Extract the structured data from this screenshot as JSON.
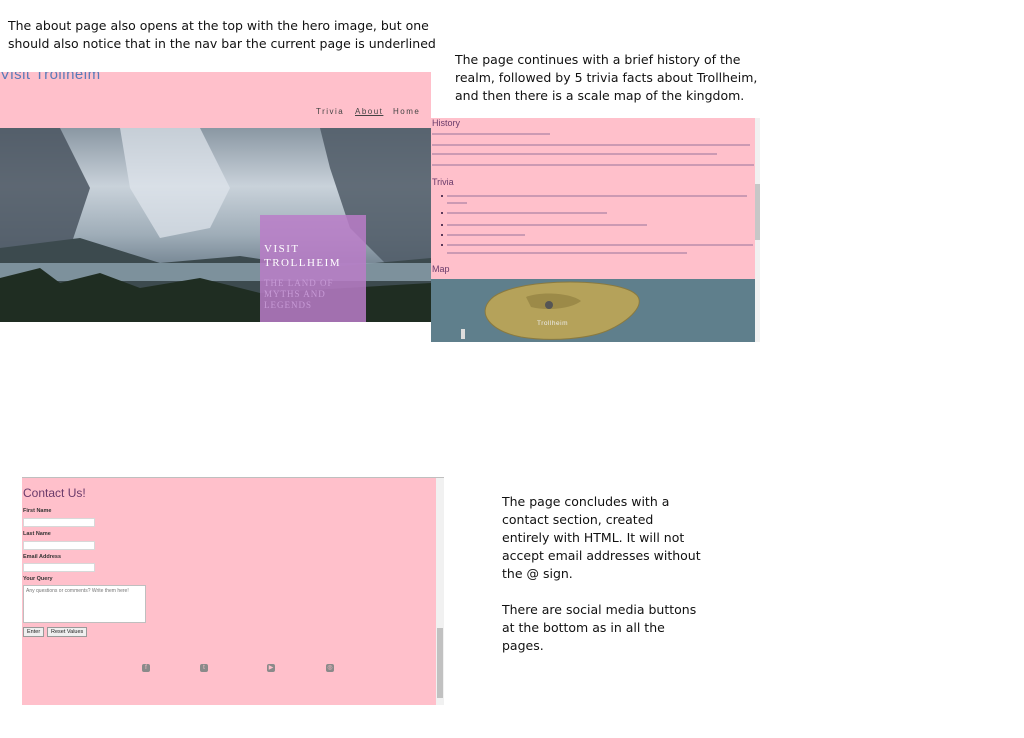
{
  "notes": {
    "top_left": "The about page also opens at the top with the hero image, but one\nshould also notice that in the  nav bar the current page is underlined",
    "top_right": "The page continues with a brief history of the\nrealm, followed by 5 trivia facts about Trollheim,\nand then there is a scale map of the kingdom.",
    "bottom_right_1": "The page concludes with a\ncontact section, created\nentirely with HTML. It will not\naccept email addresses without\nthe @ sign.",
    "bottom_right_2": "There are social media buttons\nat the bottom as in all the\npages."
  },
  "hero": {
    "site_title": "Visit Trollheim",
    "nav": [
      "Trivia",
      "About",
      "Home"
    ],
    "current_nav": "About",
    "box_title": "VISIT\nTROLLHEIM",
    "box_subtitle": "THE LAND OF\nMYTHS AND\nLEGENDS"
  },
  "history": {
    "history_heading": "History",
    "trivia_heading": "Trivia",
    "map_heading": "Map",
    "map_label": "Trollheim"
  },
  "contact": {
    "title": "Contact Us!",
    "first_name_label": "First Name",
    "last_name_label": "Last Name",
    "email_label": "Email Address",
    "query_label": "Your Query",
    "query_placeholder": "Any questions or comments? Write them here!",
    "submit_label": "Enter",
    "reset_label": "Reset Values"
  },
  "social_icons": [
    "facebook-icon",
    "twitter-icon",
    "youtube-icon",
    "instagram-icon"
  ],
  "colors": {
    "page_background": "#ffc0cb",
    "hero_box": "#ba7dc8",
    "heading": "#6a3a6a",
    "site_title": "#5a7bb8"
  }
}
